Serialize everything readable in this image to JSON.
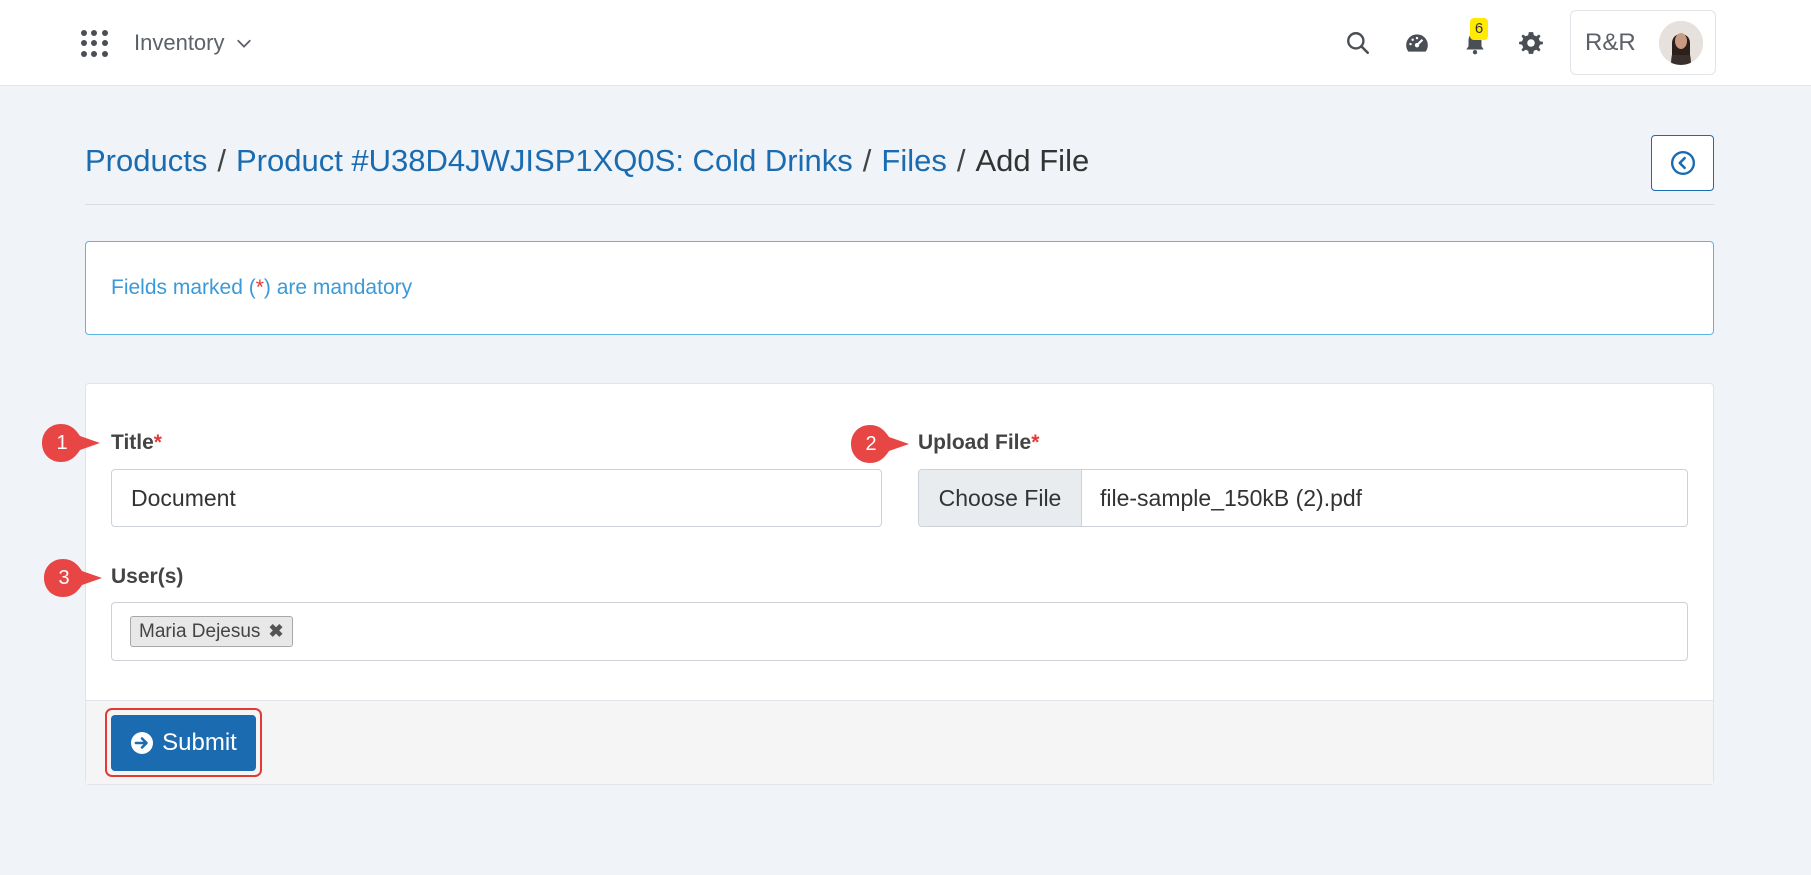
{
  "topbar": {
    "module_label": "Inventory",
    "notification_count": "6",
    "user_initials": "R&R",
    "icons": [
      "apps-grid-icon",
      "chevron-down-icon",
      "search-icon",
      "dashboard-gauge-icon",
      "bell-icon",
      "gear-icon",
      "avatar"
    ]
  },
  "breadcrumb": {
    "items": [
      "Products",
      "Product #U38D4JWJISP1XQ0S: Cold Drinks",
      "Files"
    ],
    "current": "Add File",
    "separator": "/"
  },
  "alert": {
    "prefix": "Fields marked (",
    "star": "*",
    "suffix": ") are mandatory"
  },
  "form": {
    "title_label": "Title",
    "title_value": "Document",
    "upload_label": "Upload File",
    "choose_file_label": "Choose File",
    "file_name": "file-sample_150kB (2).pdf",
    "users_label": "User(s)",
    "users": [
      "Maria Dejesus"
    ],
    "required_marker": "*",
    "submit_label": "Submit"
  },
  "callouts": [
    "1",
    "2",
    "3"
  ],
  "colors": {
    "primary": "#1a6bb0",
    "info": "#3a9ad9",
    "required": "#e53935",
    "callout": "#e84545",
    "badge": "#ffea00"
  }
}
